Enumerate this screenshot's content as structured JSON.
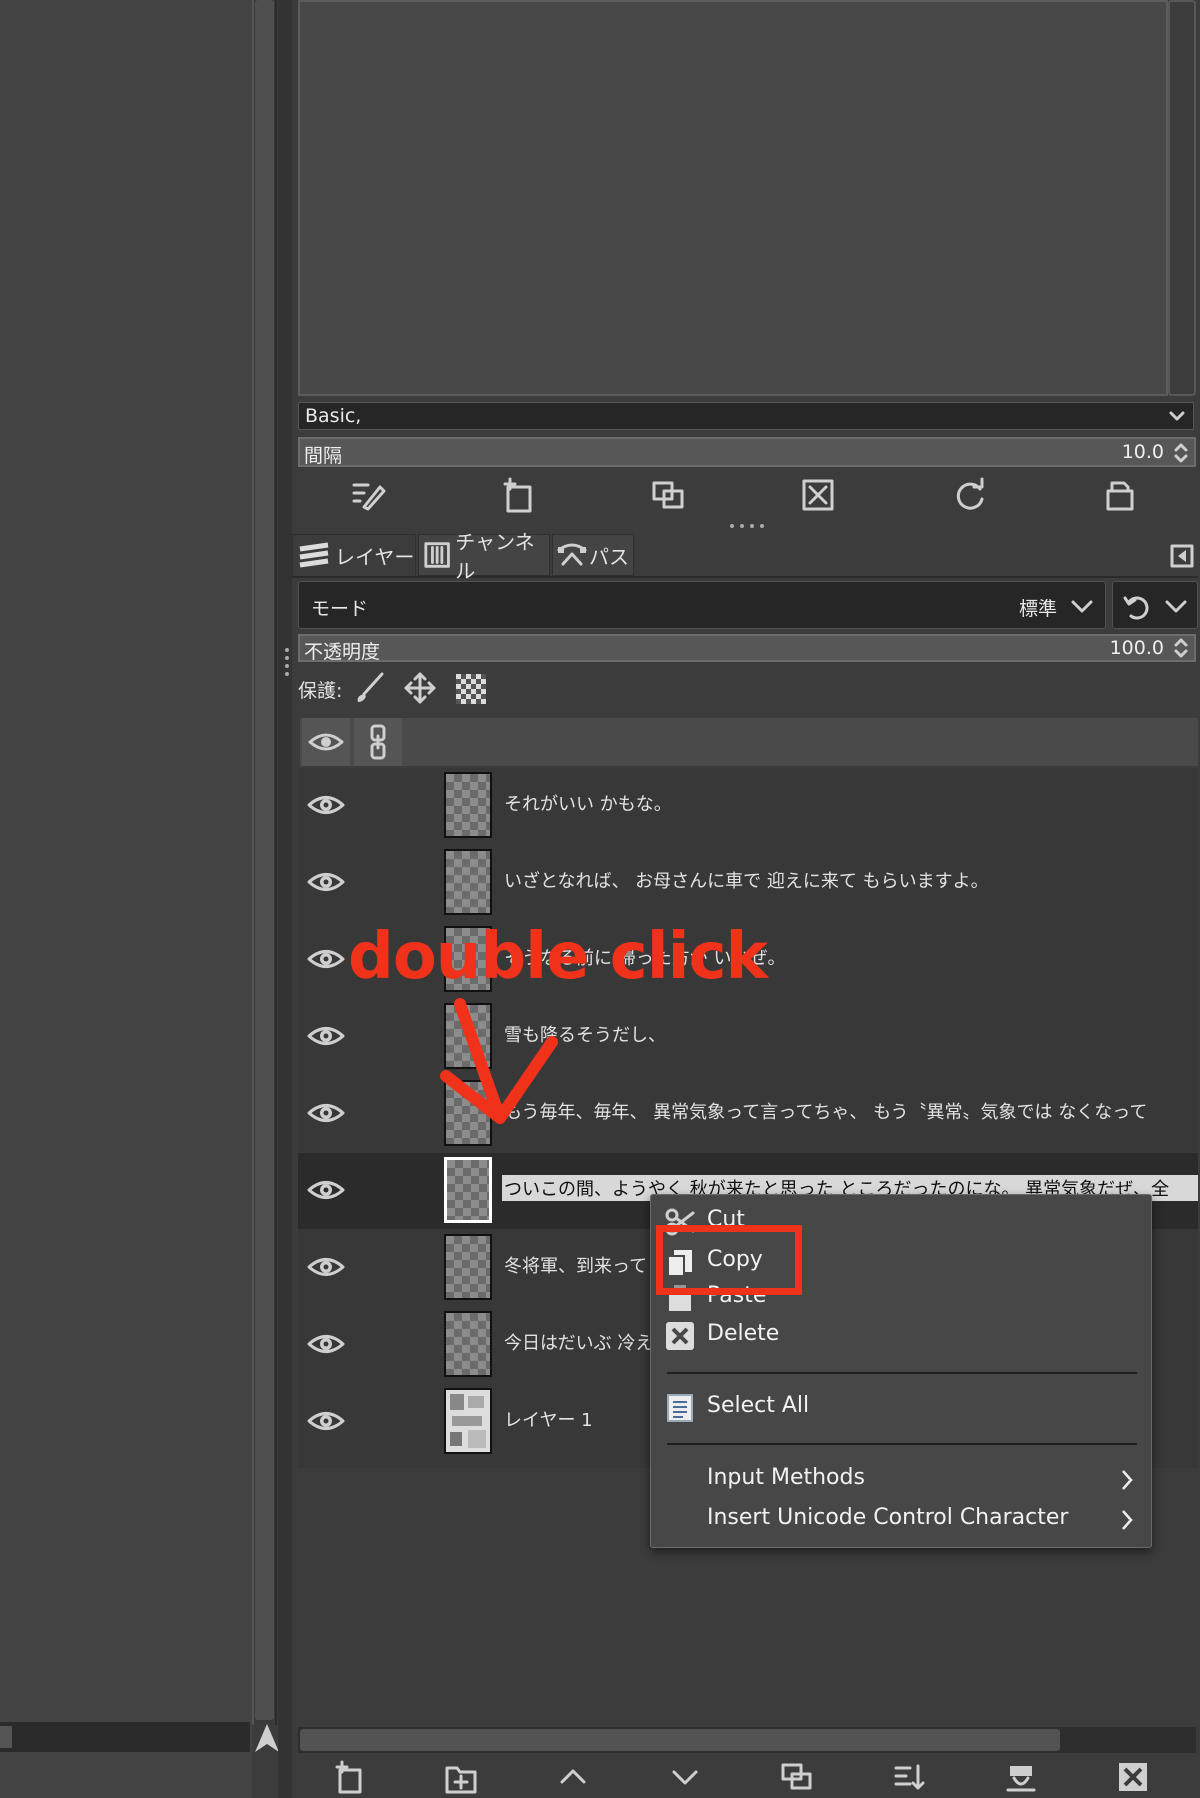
{
  "brush_panel": {
    "preset": "Basic,",
    "spacing_label": "間隔",
    "spacing_value": "10.0"
  },
  "tabs": [
    {
      "label": "レイヤー",
      "icon": "layers-icon"
    },
    {
      "label": "チャンネル",
      "icon": "channels-icon"
    },
    {
      "label": "パス",
      "icon": "paths-icon"
    }
  ],
  "layers_panel": {
    "mode_label": "モード",
    "mode_value": "標準",
    "opacity_label": "不透明度",
    "opacity_value": "100.0",
    "lock_label": "保護:"
  },
  "layers": [
    {
      "name": "それがいい かもな。",
      "selected": false
    },
    {
      "name": "いざとなれば、 お母さんに車で 迎えに来て もらいますよ。",
      "selected": false
    },
    {
      "name": "そうなる前に 帰った方が いいぜ。",
      "selected": false
    },
    {
      "name": "雪も降るそうだし、",
      "selected": false
    },
    {
      "name": "もう毎年、毎年、 異常気象って言ってちゃ、 もう〝異常〟気象では なくなって",
      "selected": false
    },
    {
      "name": "ついこの間、ようやく 秋が来たと思った ところだったのにな。 異常気象だぜ、全",
      "selected": true
    },
    {
      "name": "冬将軍、到来って",
      "selected": false
    },
    {
      "name": "今日はだいぶ 冷え",
      "selected": false
    },
    {
      "name": "レイヤー 1",
      "selected": false,
      "thumbnail": "photo"
    }
  ],
  "context_menu": {
    "items": [
      {
        "label": "Cut",
        "icon": "scissors-icon"
      },
      {
        "label": "Copy",
        "icon": "copy-icon"
      },
      {
        "label": "Paste",
        "icon": "paste-icon"
      },
      {
        "label": "Delete",
        "icon": "delete-icon"
      },
      {
        "label": "Select All",
        "icon": "select-all-icon"
      },
      {
        "label": "Input Methods",
        "submenu": true
      },
      {
        "label": "Insert Unicode Control Character",
        "submenu": true
      }
    ]
  },
  "annotation": {
    "text": "double click",
    "color": "#f0321a"
  }
}
